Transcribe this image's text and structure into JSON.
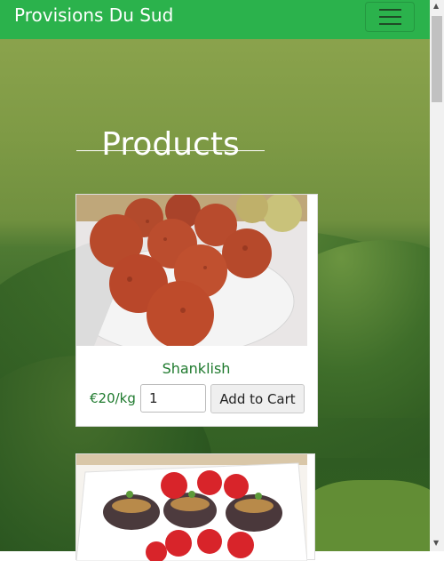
{
  "navbar": {
    "brand": "Provisions Du Sud",
    "menu_icon": "hamburger-icon",
    "color": "#2bb24c"
  },
  "main": {
    "title": "Products"
  },
  "products": [
    {
      "name": "Shanklish",
      "price": "€20/kg",
      "quantity": "1",
      "add_label": "Add to Cart",
      "image": "shanklish-balls-photo"
    },
    {
      "image": "stuffed-eggplant-photo"
    }
  ],
  "colors": {
    "accent": "#2bb24c",
    "product_text": "#1f7a2e"
  }
}
